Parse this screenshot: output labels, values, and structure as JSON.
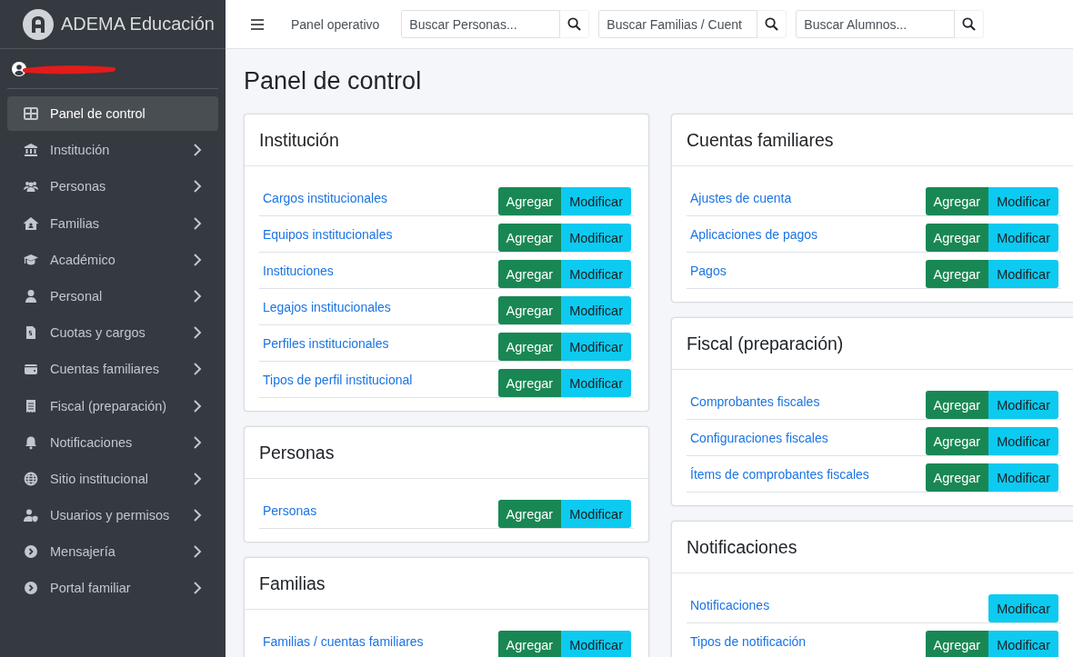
{
  "brand": {
    "name": "ADEMA Educación"
  },
  "sidebar": {
    "items": [
      {
        "label": "Panel de control",
        "selected": true,
        "expandable": false
      },
      {
        "label": "Institución",
        "selected": false,
        "expandable": true
      },
      {
        "label": "Personas",
        "selected": false,
        "expandable": true
      },
      {
        "label": "Familias",
        "selected": false,
        "expandable": true
      },
      {
        "label": "Académico",
        "selected": false,
        "expandable": true
      },
      {
        "label": "Personal",
        "selected": false,
        "expandable": true
      },
      {
        "label": "Cuotas y cargos",
        "selected": false,
        "expandable": true
      },
      {
        "label": "Cuentas familiares",
        "selected": false,
        "expandable": true
      },
      {
        "label": "Fiscal (preparación)",
        "selected": false,
        "expandable": true
      },
      {
        "label": "Notificaciones",
        "selected": false,
        "expandable": true
      },
      {
        "label": "Sitio institucional",
        "selected": false,
        "expandable": true
      },
      {
        "label": "Usuarios y permisos",
        "selected": false,
        "expandable": true
      },
      {
        "label": "Mensajería",
        "selected": false,
        "expandable": true
      },
      {
        "label": "Portal familiar",
        "selected": false,
        "expandable": true
      }
    ]
  },
  "topbar": {
    "link": "Panel operativo",
    "searches": [
      {
        "placeholder": "Buscar Personas..."
      },
      {
        "placeholder": "Buscar Familias / Cuent"
      },
      {
        "placeholder": "Buscar Alumnos..."
      }
    ]
  },
  "page_title": "Panel de control",
  "columns": [
    [
      {
        "title": "Institución",
        "rows": [
          {
            "link": "Cargos institucionales",
            "actions": [
              {
                "kind": "add",
                "label": "Agregar"
              },
              {
                "kind": "edit",
                "label": "Modificar"
              }
            ]
          },
          {
            "link": "Equipos institucionales",
            "actions": [
              {
                "kind": "add",
                "label": "Agregar"
              },
              {
                "kind": "edit",
                "label": "Modificar"
              }
            ]
          },
          {
            "link": "Instituciones",
            "actions": [
              {
                "kind": "add",
                "label": "Agregar"
              },
              {
                "kind": "edit",
                "label": "Modificar"
              }
            ]
          },
          {
            "link": "Legajos institucionales",
            "actions": [
              {
                "kind": "add",
                "label": "Agregar"
              },
              {
                "kind": "edit",
                "label": "Modificar"
              }
            ]
          },
          {
            "link": "Perfiles institucionales",
            "actions": [
              {
                "kind": "add",
                "label": "Agregar"
              },
              {
                "kind": "edit",
                "label": "Modificar"
              }
            ]
          },
          {
            "link": "Tipos de perfil institucional",
            "actions": [
              {
                "kind": "add",
                "label": "Agregar"
              },
              {
                "kind": "edit",
                "label": "Modificar"
              }
            ]
          }
        ]
      },
      {
        "title": "Personas",
        "rows": [
          {
            "link": "Personas",
            "actions": [
              {
                "kind": "add",
                "label": "Agregar"
              },
              {
                "kind": "edit",
                "label": "Modificar"
              }
            ]
          }
        ]
      },
      {
        "title": "Familias",
        "rows": [
          {
            "link": "Familias / cuentas familiares",
            "actions": [
              {
                "kind": "add",
                "label": "Agregar"
              },
              {
                "kind": "edit",
                "label": "Modificar"
              }
            ]
          }
        ]
      }
    ],
    [
      {
        "title": "Cuentas familiares",
        "rows": [
          {
            "link": "Ajustes de cuenta",
            "actions": [
              {
                "kind": "add",
                "label": "Agregar"
              },
              {
                "kind": "edit",
                "label": "Modificar"
              }
            ]
          },
          {
            "link": "Aplicaciones de pagos",
            "actions": [
              {
                "kind": "add",
                "label": "Agregar"
              },
              {
                "kind": "edit",
                "label": "Modificar"
              }
            ]
          },
          {
            "link": "Pagos",
            "actions": [
              {
                "kind": "add",
                "label": "Agregar"
              },
              {
                "kind": "edit",
                "label": "Modificar"
              }
            ]
          }
        ]
      },
      {
        "title": "Fiscal (preparación)",
        "rows": [
          {
            "link": "Comprobantes fiscales",
            "actions": [
              {
                "kind": "add",
                "label": "Agregar"
              },
              {
                "kind": "edit",
                "label": "Modificar"
              }
            ]
          },
          {
            "link": "Configuraciones fiscales",
            "actions": [
              {
                "kind": "add",
                "label": "Agregar"
              },
              {
                "kind": "edit",
                "label": "Modificar"
              }
            ]
          },
          {
            "link": "Ítems de comprobantes fiscales",
            "actions": [
              {
                "kind": "add",
                "label": "Agregar"
              },
              {
                "kind": "edit",
                "label": "Modificar"
              }
            ]
          }
        ]
      },
      {
        "title": "Notificaciones",
        "rows": [
          {
            "link": "Notificaciones",
            "actions": [
              {
                "kind": "edit",
                "label": "Modificar"
              }
            ]
          },
          {
            "link": "Tipos de notificación",
            "actions": [
              {
                "kind": "add",
                "label": "Agregar"
              },
              {
                "kind": "edit",
                "label": "Modificar"
              }
            ]
          }
        ]
      }
    ]
  ]
}
